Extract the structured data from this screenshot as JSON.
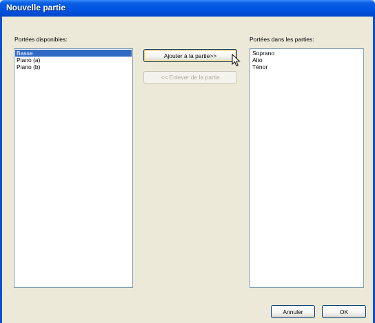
{
  "window": {
    "title": "Nouvelle partie"
  },
  "available": {
    "label": "Portées disponibles:",
    "items": [
      "Basse",
      "Piano (a)",
      "Piano (b)"
    ],
    "selected_index": 0
  },
  "in_parts": {
    "label": "Portées dans les parties:",
    "items": [
      "Soprano",
      "Alto",
      "Ténor"
    ]
  },
  "buttons": {
    "add": "Ajouter à la partie>>",
    "remove": "<< Enlever de la partie",
    "cancel": "Annuler",
    "ok": "OK"
  },
  "colors": {
    "title_bar": "#0154e3",
    "selection": "#316ac5",
    "dialog_bg": "#ece9d8"
  },
  "icons": {
    "pointer": "arrow-cursor-icon"
  }
}
